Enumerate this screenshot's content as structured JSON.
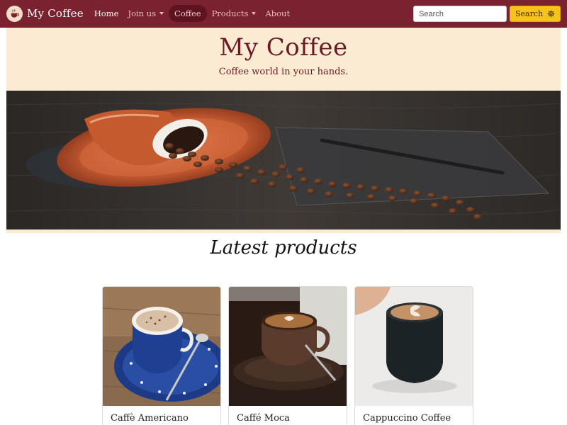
{
  "brand": {
    "name": "My Coffee",
    "logo_icon": "coffee-cup-icon"
  },
  "nav": {
    "items": [
      {
        "label": "Home"
      },
      {
        "label": "Join us"
      },
      {
        "label": "Coffee"
      },
      {
        "label": "Products"
      },
      {
        "label": "About"
      }
    ]
  },
  "search": {
    "placeholder": "Search",
    "button_label": "Search",
    "button_icon": "gear-icon"
  },
  "hero": {
    "title": "My Coffee",
    "subtitle": "Coffee world in your hands."
  },
  "latest": {
    "title": "Latest products"
  },
  "products": [
    {
      "name": "Caffè Americano"
    },
    {
      "name": "Caffé Moca"
    },
    {
      "name": "Cappuccino Coffee"
    }
  ],
  "colors": {
    "navbar": "#7a2230",
    "hero_bg": "#fcebd3",
    "accent": "#f7c21a",
    "title": "#6a1a24"
  }
}
